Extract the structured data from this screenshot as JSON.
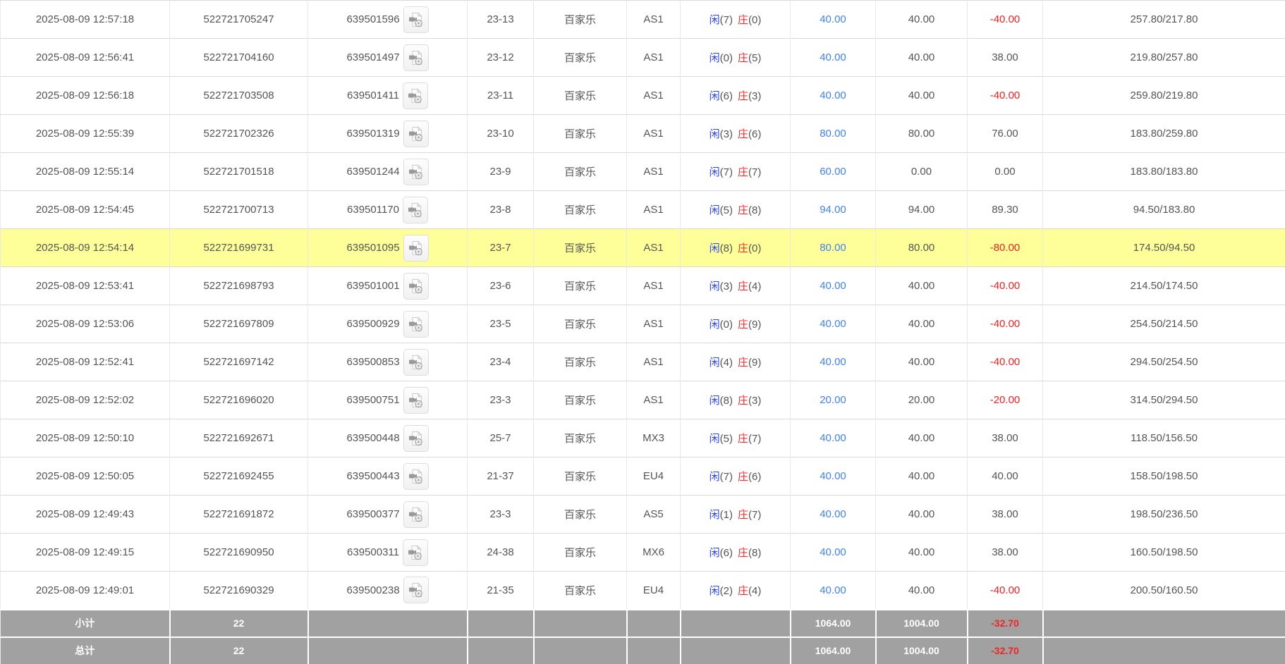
{
  "colors": {
    "bet_link": "#4183f1",
    "player": "#2c49ee",
    "banker": "#f13131",
    "negative": "#f52222",
    "highlight_row": "#ffff99",
    "footer_bg": "#a1a1a1",
    "row_text": "#555555"
  },
  "icons": {
    "game_record": "video-film-document-icon"
  },
  "table": {
    "rows": [
      {
        "time": "2025-08-09 12:57:18",
        "order_no": "522721705247",
        "game_no": "639501596",
        "round": "23-13",
        "game_type": "百家乐",
        "table_name": "AS1",
        "player_label": "闲",
        "player_points": "(7)",
        "banker_label": "庄",
        "banker_points": "(0)",
        "bet_amount": "40.00",
        "valid_amount": "40.00",
        "win_loss": "-40.00",
        "balance": "257.80/217.80",
        "highlight": false
      },
      {
        "time": "2025-08-09 12:56:41",
        "order_no": "522721704160",
        "game_no": "639501497",
        "round": "23-12",
        "game_type": "百家乐",
        "table_name": "AS1",
        "player_label": "闲",
        "player_points": "(0)",
        "banker_label": "庄",
        "banker_points": "(5)",
        "bet_amount": "40.00",
        "valid_amount": "40.00",
        "win_loss": "38.00",
        "balance": "219.80/257.80",
        "highlight": false
      },
      {
        "time": "2025-08-09 12:56:18",
        "order_no": "522721703508",
        "game_no": "639501411",
        "round": "23-11",
        "game_type": "百家乐",
        "table_name": "AS1",
        "player_label": "闲",
        "player_points": "(6)",
        "banker_label": "庄",
        "banker_points": "(3)",
        "bet_amount": "40.00",
        "valid_amount": "40.00",
        "win_loss": "-40.00",
        "balance": "259.80/219.80",
        "highlight": false
      },
      {
        "time": "2025-08-09 12:55:39",
        "order_no": "522721702326",
        "game_no": "639501319",
        "round": "23-10",
        "game_type": "百家乐",
        "table_name": "AS1",
        "player_label": "闲",
        "player_points": "(3)",
        "banker_label": "庄",
        "banker_points": "(6)",
        "bet_amount": "80.00",
        "valid_amount": "80.00",
        "win_loss": "76.00",
        "balance": "183.80/259.80",
        "highlight": false
      },
      {
        "time": "2025-08-09 12:55:14",
        "order_no": "522721701518",
        "game_no": "639501244",
        "round": "23-9",
        "game_type": "百家乐",
        "table_name": "AS1",
        "player_label": "闲",
        "player_points": "(7)",
        "banker_label": "庄",
        "banker_points": "(7)",
        "bet_amount": "60.00",
        "valid_amount": "0.00",
        "win_loss": "0.00",
        "balance": "183.80/183.80",
        "highlight": false
      },
      {
        "time": "2025-08-09 12:54:45",
        "order_no": "522721700713",
        "game_no": "639501170",
        "round": "23-8",
        "game_type": "百家乐",
        "table_name": "AS1",
        "player_label": "闲",
        "player_points": "(5)",
        "banker_label": "庄",
        "banker_points": "(8)",
        "bet_amount": "94.00",
        "valid_amount": "94.00",
        "win_loss": "89.30",
        "balance": "94.50/183.80",
        "highlight": false
      },
      {
        "time": "2025-08-09 12:54:14",
        "order_no": "522721699731",
        "game_no": "639501095",
        "round": "23-7",
        "game_type": "百家乐",
        "table_name": "AS1",
        "player_label": "闲",
        "player_points": "(8)",
        "banker_label": "庄",
        "banker_points": "(0)",
        "bet_amount": "80.00",
        "valid_amount": "80.00",
        "win_loss": "-80.00",
        "balance": "174.50/94.50",
        "highlight": true
      },
      {
        "time": "2025-08-09 12:53:41",
        "order_no": "522721698793",
        "game_no": "639501001",
        "round": "23-6",
        "game_type": "百家乐",
        "table_name": "AS1",
        "player_label": "闲",
        "player_points": "(3)",
        "banker_label": "庄",
        "banker_points": "(4)",
        "bet_amount": "40.00",
        "valid_amount": "40.00",
        "win_loss": "-40.00",
        "balance": "214.50/174.50",
        "highlight": false
      },
      {
        "time": "2025-08-09 12:53:06",
        "order_no": "522721697809",
        "game_no": "639500929",
        "round": "23-5",
        "game_type": "百家乐",
        "table_name": "AS1",
        "player_label": "闲",
        "player_points": "(0)",
        "banker_label": "庄",
        "banker_points": "(9)",
        "bet_amount": "40.00",
        "valid_amount": "40.00",
        "win_loss": "-40.00",
        "balance": "254.50/214.50",
        "highlight": false
      },
      {
        "time": "2025-08-09 12:52:41",
        "order_no": "522721697142",
        "game_no": "639500853",
        "round": "23-4",
        "game_type": "百家乐",
        "table_name": "AS1",
        "player_label": "闲",
        "player_points": "(4)",
        "banker_label": "庄",
        "banker_points": "(9)",
        "bet_amount": "40.00",
        "valid_amount": "40.00",
        "win_loss": "-40.00",
        "balance": "294.50/254.50",
        "highlight": false
      },
      {
        "time": "2025-08-09 12:52:02",
        "order_no": "522721696020",
        "game_no": "639500751",
        "round": "23-3",
        "game_type": "百家乐",
        "table_name": "AS1",
        "player_label": "闲",
        "player_points": "(8)",
        "banker_label": "庄",
        "banker_points": "(3)",
        "bet_amount": "20.00",
        "valid_amount": "20.00",
        "win_loss": "-20.00",
        "balance": "314.50/294.50",
        "highlight": false
      },
      {
        "time": "2025-08-09 12:50:10",
        "order_no": "522721692671",
        "game_no": "639500448",
        "round": "25-7",
        "game_type": "百家乐",
        "table_name": "MX3",
        "player_label": "闲",
        "player_points": "(5)",
        "banker_label": "庄",
        "banker_points": "(7)",
        "bet_amount": "40.00",
        "valid_amount": "40.00",
        "win_loss": "38.00",
        "balance": "118.50/156.50",
        "highlight": false
      },
      {
        "time": "2025-08-09 12:50:05",
        "order_no": "522721692455",
        "game_no": "639500443",
        "round": "21-37",
        "game_type": "百家乐",
        "table_name": "EU4",
        "player_label": "闲",
        "player_points": "(7)",
        "banker_label": "庄",
        "banker_points": "(6)",
        "bet_amount": "40.00",
        "valid_amount": "40.00",
        "win_loss": "40.00",
        "balance": "158.50/198.50",
        "highlight": false
      },
      {
        "time": "2025-08-09 12:49:43",
        "order_no": "522721691872",
        "game_no": "639500377",
        "round": "23-3",
        "game_type": "百家乐",
        "table_name": "AS5",
        "player_label": "闲",
        "player_points": "(1)",
        "banker_label": "庄",
        "banker_points": "(7)",
        "bet_amount": "40.00",
        "valid_amount": "40.00",
        "win_loss": "38.00",
        "balance": "198.50/236.50",
        "highlight": false
      },
      {
        "time": "2025-08-09 12:49:15",
        "order_no": "522721690950",
        "game_no": "639500311",
        "round": "24-38",
        "game_type": "百家乐",
        "table_name": "MX6",
        "player_label": "闲",
        "player_points": "(6)",
        "banker_label": "庄",
        "banker_points": "(8)",
        "bet_amount": "40.00",
        "valid_amount": "40.00",
        "win_loss": "38.00",
        "balance": "160.50/198.50",
        "highlight": false
      },
      {
        "time": "2025-08-09 12:49:01",
        "order_no": "522721690329",
        "game_no": "639500238",
        "round": "21-35",
        "game_type": "百家乐",
        "table_name": "EU4",
        "player_label": "闲",
        "player_points": "(2)",
        "banker_label": "庄",
        "banker_points": "(4)",
        "bet_amount": "40.00",
        "valid_amount": "40.00",
        "win_loss": "-40.00",
        "balance": "200.50/160.50",
        "highlight": false
      }
    ],
    "footer": [
      {
        "label": "小计",
        "count": "22",
        "bet_total": "1064.00",
        "valid_total": "1004.00",
        "win_loss_total": "-32.70"
      },
      {
        "label": "总计",
        "count": "22",
        "bet_total": "1064.00",
        "valid_total": "1004.00",
        "win_loss_total": "-32.70"
      }
    ]
  }
}
